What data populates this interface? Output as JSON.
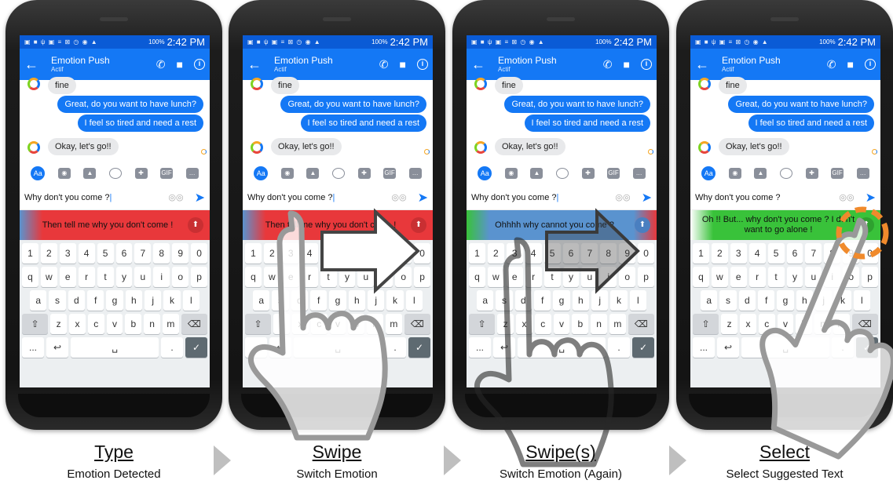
{
  "panels": [
    {
      "status_time": "2:42 PM",
      "battery": "100%",
      "contact_name": "Emotion Push",
      "contact_status": "Actif",
      "messages": {
        "fine": "fine",
        "lunch": "Great, do you want to have lunch?",
        "tired": "I feel so tired and need a rest",
        "go": "Okay, let's go!!"
      },
      "input_text": "Why don't you come ?",
      "suggestion": "Then tell me why you don't come !",
      "suggestion_color": "#e8383b",
      "caption_title": "Type",
      "caption_subtitle": "Emotion Detected"
    },
    {
      "status_time": "2:42 PM",
      "battery": "100%",
      "contact_name": "Emotion Push",
      "contact_status": "Actif",
      "messages": {
        "fine": "fine",
        "lunch": "Great, do you want to have lunch?",
        "tired": "I feel so tired and need a rest",
        "go": "Okay, let's go!!"
      },
      "input_text": "Why don't you come ?",
      "suggestion": "Then tell me why you don't come !",
      "suggestion_color": "#e8383b",
      "caption_title": "Swipe",
      "caption_subtitle": "Switch Emotion"
    },
    {
      "status_time": "2:42 PM",
      "battery": "100%",
      "contact_name": "Emotion Push",
      "contact_status": "Actif",
      "messages": {
        "fine": "fine",
        "lunch": "Great, do you want to have lunch?",
        "tired": "I feel so tired and need a rest",
        "go": "Okay, let's go!!"
      },
      "input_text": "Why don't you come ?",
      "suggestion": "Ohhhh why cannot you come ?",
      "suggestion_color": "#5a93cf",
      "caption_title": "Swipe(s)",
      "caption_subtitle": "Switch Emotion (Again)"
    },
    {
      "status_time": "2:42 PM",
      "battery": "100%",
      "contact_name": "Emotion Push",
      "contact_status": "Actif",
      "messages": {
        "fine": "fine",
        "lunch": "Great, do you want to have lunch?",
        "tired": "I feel so tired and need a rest",
        "go": "Okay, let's go!!"
      },
      "input_text": "Why don't you come ?",
      "suggestion": "Oh !! But... why don't you come ? I don't want to go alone !",
      "suggestion_color": "#39c23a",
      "caption_title": "Select",
      "caption_subtitle": "Select Suggested Text"
    }
  ],
  "toolbar": [
    "Aa",
    "camera",
    "image",
    "emoji",
    "game",
    "GIF",
    "more"
  ],
  "keyboard": {
    "row1": [
      "1",
      "2",
      "3",
      "4",
      "5",
      "6",
      "7",
      "8",
      "9",
      "0"
    ],
    "row2": [
      "q",
      "w",
      "e",
      "r",
      "t",
      "y",
      "u",
      "i",
      "o",
      "p"
    ],
    "row3": [
      "a",
      "s",
      "d",
      "f",
      "g",
      "h",
      "j",
      "k",
      "l"
    ],
    "row4": [
      "⇧",
      "z",
      "x",
      "c",
      "v",
      "b",
      "n",
      "m",
      "⌫"
    ],
    "row5": [
      "...",
      "↩",
      "␣",
      ".",
      "✓"
    ]
  },
  "icons": {
    "back": "back-arrow-icon",
    "phone": "phone-icon",
    "video": "video-icon",
    "info": "info-icon",
    "send": "send-icon",
    "arrow": "swipe-arrow-icon",
    "select": "select-circle-icon",
    "hand": "hand-pointer-icon"
  },
  "colors": {
    "app_blue": "#1478f5",
    "status_blue": "#0a5bd6",
    "angry_red": "#e8383b",
    "sad_blue": "#5a93cf",
    "calm_green": "#39c23a",
    "highlight_orange": "#f08a2c"
  }
}
